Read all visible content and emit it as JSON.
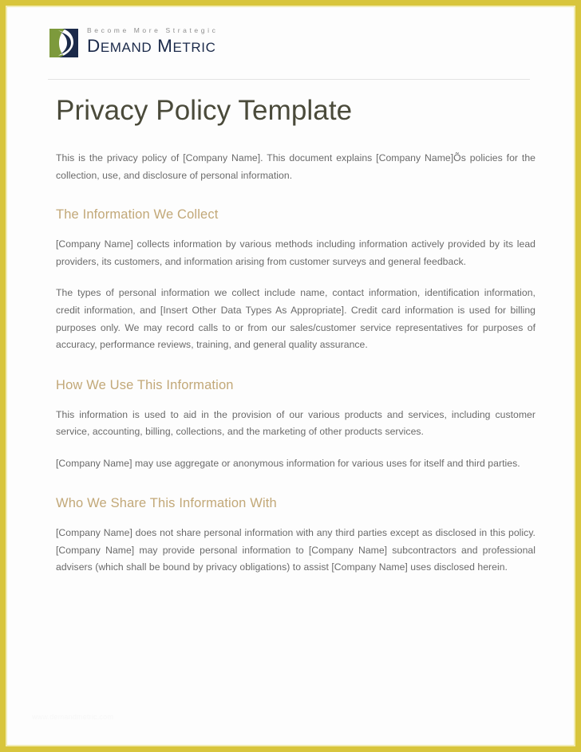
{
  "page": {
    "border_color": "#d8c53c",
    "background_color": "#fdfdfd"
  },
  "header": {
    "logo": {
      "mark_name": "demand-metric-logo-mark",
      "green_color": "#7d9a3c",
      "navy_color": "#1b2a4a",
      "tagline": "Become More Strategic",
      "wordmark_lead_d": "D",
      "wordmark_emand": "EMAND",
      "wordmark_lead_m": "M",
      "wordmark_etric": "ETRIC",
      "wordmark_full": "DEMAND METRIC"
    }
  },
  "document": {
    "title": "Privacy Policy Template",
    "title_color": "#4a4a3a",
    "heading_color": "#c2a878",
    "body_color": "#6a6a6a",
    "intro_paragraph": "This is the privacy policy of [Company Name]. This document explains [Company Name]Õs policies for the collection, use, and disclosure of personal information.",
    "sections": [
      {
        "heading": "The Information We Collect",
        "paragraphs": [
          "[Company Name] collects information by various methods including information actively provided by its lead providers, its customers, and information arising from customer surveys and general feedback.",
          "The types of personal information we collect include name, contact information, identification information, credit information, and [Insert Other Data Types As Appropriate]. Credit card information is used for billing purposes only. We may record calls to or from our sales/customer service representatives for purposes of accuracy, performance reviews, training, and general quality assurance."
        ]
      },
      {
        "heading": "How We Use This Information",
        "paragraphs": [
          "This information is used to aid in the provision of our various products and services, including customer service, accounting, billing, collections, and the marketing of other products services.",
          "[Company Name] may use aggregate or anonymous information for various uses for itself and third parties."
        ]
      },
      {
        "heading": "Who We Share This Information With",
        "paragraphs": [
          "[Company Name] does not share personal information with any third parties except as disclosed in this policy. [Company Name] may provide personal information to [Company Name] subcontractors and professional advisers (which shall be bound by privacy obligations) to assist [Company Name] uses disclosed herein."
        ]
      }
    ]
  },
  "footer": {
    "watermark": "www.demandmetric.com"
  }
}
